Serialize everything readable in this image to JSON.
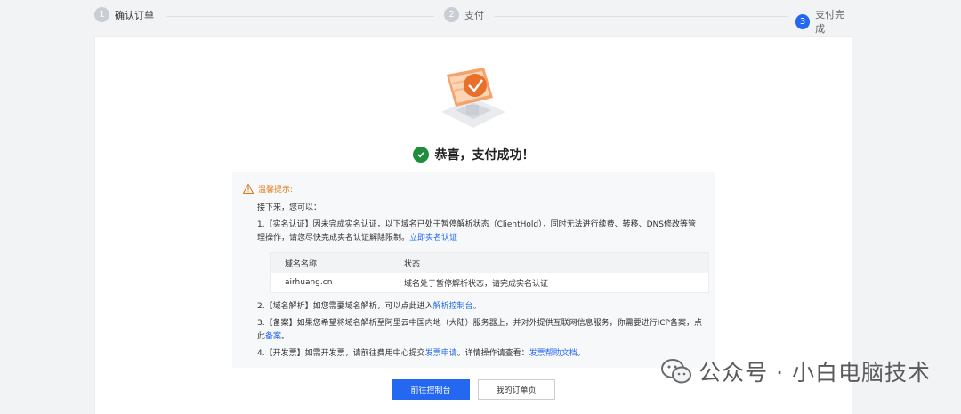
{
  "steps": [
    {
      "num": "1",
      "label": "确认订单"
    },
    {
      "num": "2",
      "label": "支付"
    },
    {
      "num": "3",
      "label": "支付完成"
    }
  ],
  "success": {
    "text": "恭喜，支付成功！"
  },
  "notice": {
    "title": "温馨提示:",
    "intro": "接下来，您可以：",
    "item1_text": "1.【实名认证】因未完成实名认证，以下域名已处于暂停解析状态（ClientHold），同时无法进行续费、转移、DNS修改等管理操作，请您尽快完成实名认证解除限制。",
    "item1_link": "立即实名认证",
    "table": {
      "headers": [
        "域名名称",
        "状态"
      ],
      "rows": [
        [
          "airhuang.cn",
          "域名处于暂停解析状态，请完成实名认证"
        ]
      ]
    },
    "item2_text": "2.【域名解析】如您需要域名解析，可以点此进入",
    "item2_link": "解析控制台",
    "item2_end": "。",
    "item3_text": "3.【备案】如果您希望将域名解析至阿里云中国内地（大陆）服务器上，并对外提供互联网信息服务，你需要进行ICP备案，点此",
    "item3_link": "备案",
    "item3_end": "。",
    "item4_text": "4.【开发票】如需开发票，请前往费用中心提交",
    "item4_link1": "发票申请",
    "item4_mid": "。详情操作请查看：",
    "item4_link2": "发票帮助文档",
    "item4_end": "。"
  },
  "buttons": {
    "primary": "前往控制台",
    "secondary": "我的订单页"
  },
  "watermark": {
    "text": "公众号 · 小白电脑技术"
  },
  "colors": {
    "accent": "#2468f2",
    "success": "#1e8e3e",
    "warning": "#e07b1a"
  }
}
